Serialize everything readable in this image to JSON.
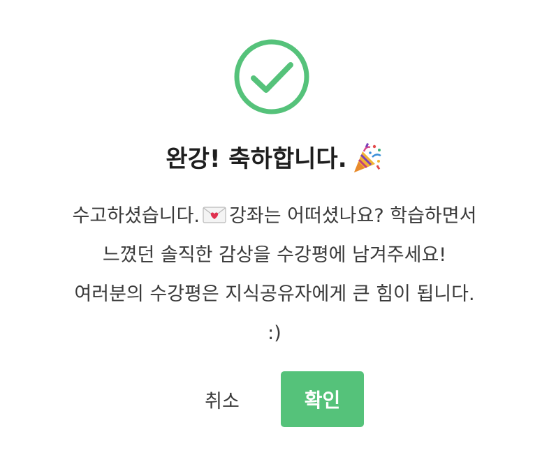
{
  "dialog": {
    "title": "완강! 축하합니다.",
    "title_emoji": "party-popper-icon",
    "message_part1": "수고하셨습니다.",
    "message_emoji": "love-letter-icon",
    "message_part2": "강좌는 어떠셨나요? 학습하면서 느꼈던 솔직한 감상을 수강평에 남겨주세요! 여러분의 수강평은 지식공유자에게 큰 힘이 됩니다. :)",
    "cancel_label": "취소",
    "confirm_label": "확인"
  },
  "icons": {
    "status": "check-circle-icon"
  },
  "colors": {
    "success": "#55c27a",
    "text": "#2b2b2b",
    "button_text": "#ffffff"
  }
}
